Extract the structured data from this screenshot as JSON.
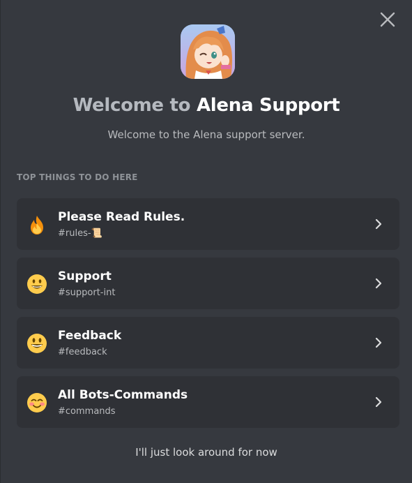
{
  "modal": {
    "title_prefix": "Welcome to",
    "title_server": "Alena Support",
    "subtitle": "Welcome to the Alena support server.",
    "section_label": "TOP THINGS TO DO HERE",
    "skip_label": "I'll just look around for now"
  },
  "todos": [
    {
      "title": "Please Read Rules.",
      "channel": "#rules-📜",
      "icon": "fire-emoji-icon"
    },
    {
      "title": "Support",
      "channel": "#support-int",
      "icon": "grinning-face-emoji-icon"
    },
    {
      "title": "Feedback",
      "channel": "#feedback",
      "icon": "smiley-face-emoji-icon"
    },
    {
      "title": "All Bots-Commands",
      "channel": "#commands",
      "icon": "blush-face-emoji-icon"
    }
  ],
  "colors": {
    "background": "#36393f",
    "card": "#2f3136",
    "title_white": "#ffffff",
    "title_dim": "#b5b9bf",
    "muted": "#8e9297"
  }
}
